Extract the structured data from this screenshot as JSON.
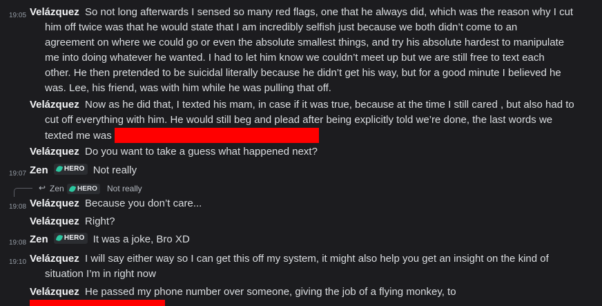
{
  "messages": [
    {
      "time": "19:05",
      "author": "Velázquez",
      "first": "So not long afterwards I sensed so many red flags, one that he always did, which was the reason why I cut",
      "lines": [
        "him off twice was that he would state that I am incredibly selfish just because we both didn’t come to an",
        "agreement on where we could go or even the absolute smallest things, and try his absolute hardest to manipulate",
        "me into doing whatever he wanted. I had to let him know we couldn’t meet up but we are still free to text each",
        "other. He then pretended to be suicidal literally because he didn’t get his way, but for a good minute I believed he",
        "was. Lee, his friend, was with him while he was pulling that off."
      ]
    },
    {
      "author": "Velázquez",
      "first": "Now as he did that, I texted his mam, in case if it was true, because at the time I still cared , but also had to",
      "lines": [
        "cut off everything with him. He would still beg and plead after being explicitly told we’re done, the last words we",
        "texted me was"
      ]
    },
    {
      "author": "Velázquez",
      "first": "Do you want to take a guess what happened next?"
    },
    {
      "time": "19:07",
      "author": "Zen",
      "badge": "HERO",
      "first": "Not really"
    },
    {
      "time": "19:08",
      "author": "Velázquez",
      "first": "Because you don’t care..."
    },
    {
      "author": "Velázquez",
      "first": "Right?"
    },
    {
      "time": "19:08",
      "author": "Zen",
      "badge": "HERO",
      "first": "It was a joke, Bro XD"
    },
    {
      "time": "19:10",
      "author": "Velázquez",
      "first": "I will say either way so I can get this off my system, it might also help you get an insight on the kind of",
      "lines": [
        "situation I’m in right now"
      ]
    },
    {
      "author": "Velázquez",
      "first": "He passed my phone number over someone, giving the job of a flying monkey, to"
    }
  ],
  "reply": {
    "author": "Zen",
    "badge": "HERO",
    "text": "Not really"
  },
  "colors": {
    "background": "#1c1c1f",
    "redaction": "#ff0000",
    "badge_leaf": "#2dc7a0"
  }
}
